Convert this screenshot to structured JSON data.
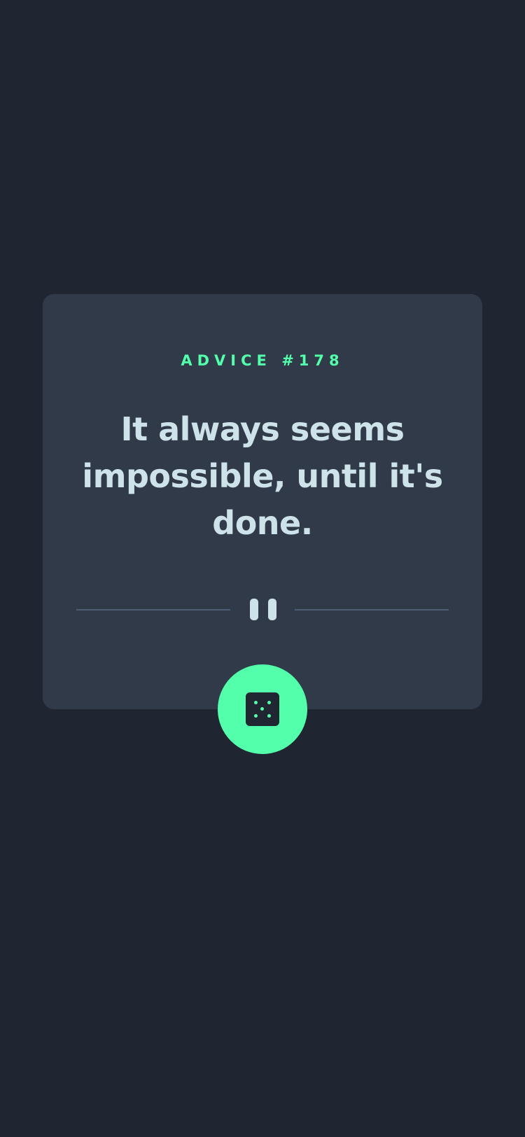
{
  "advice": {
    "label": "ADVICE #178",
    "quote": "It always seems impossible, until it's done."
  },
  "divider": {
    "icon": "pause-icon"
  },
  "button": {
    "icon": "dice-icon"
  },
  "colors": {
    "background": "#1f2631",
    "card": "#313a49",
    "accent": "#53ffaa",
    "text": "#cee3e9",
    "divider": "#4f5d74"
  }
}
